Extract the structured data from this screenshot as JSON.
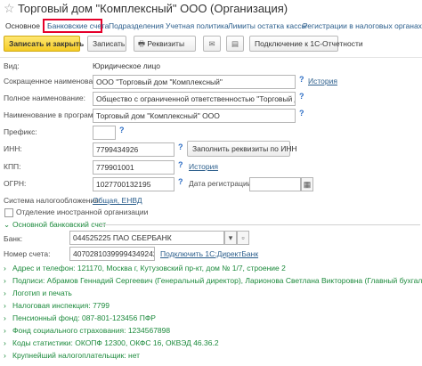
{
  "window": {
    "title": "Торговый дом \"Комплексный\" ООО (Организация)"
  },
  "tabs": [
    {
      "label": "Основное"
    },
    {
      "label": "Банковские счета"
    },
    {
      "label": "Подразделения"
    },
    {
      "label": "Учетная политика"
    },
    {
      "label": "Лимиты остатка кассы"
    },
    {
      "label": "Регистрации в налоговых органах"
    }
  ],
  "toolbar": {
    "save_close": "Записать и закрыть",
    "save": "Записать",
    "requisites": "Реквизиты",
    "connect": "Подключение к 1С-Отчетности"
  },
  "form": {
    "kind_label": "Вид:",
    "kind_value": "Юридическое лицо",
    "short_name_label": "Сокращенное наименование:",
    "short_name_value": "ООО \"Торговый дом \"Комплексный\"",
    "history": "История",
    "full_name_label": "Полное наименование:",
    "full_name_value": "Общество с ограниченной ответственностью \"Торговый дом \"Комп",
    "program_name_label": "Наименование в программе:",
    "program_name_value": "Торговый дом \"Комплексный\" ООО",
    "prefix_label": "Префикс:",
    "prefix_value": "",
    "inn_label": "ИНН:",
    "inn_value": "7799434926",
    "fill_by_inn": "Заполнить реквизиты по ИНН",
    "kpp_label": "КПП:",
    "kpp_value": "779901001",
    "kpp_history": "История",
    "ogrn_label": "ОГРН:",
    "ogrn_value": "1027700132195",
    "reg_date_label": "Дата регистрации:",
    "reg_date_value": "",
    "tax_system_label": "Система налогообложения:",
    "tax_system_value": "Общая, ЕНВД",
    "foreign_branch_label": "Отделение иностранной организации"
  },
  "bank": {
    "section_title": "Основной банковский счет",
    "bank_label": "Банк:",
    "bank_value": "044525225 ПАО СБЕРБАНК",
    "account_label": "Номер счета:",
    "account_value": "40702810399994349242",
    "direct_bank_link": "Подключить 1С:ДиректБанк"
  },
  "groups": [
    {
      "label": "Адрес и телефон: 121170, Москва г, Кутузовский пр-кт, дом № 1/7, строение 2"
    },
    {
      "label": "Подписи: Абрамов Геннадий Сергеевич (Генеральный директор), Ларионова Светлана Викторовна (Главный бухгалтер)"
    },
    {
      "label": "Логотип и печать"
    },
    {
      "label": "Налоговая инспекция: 7799"
    },
    {
      "label": "Пенсионный фонд: 087-801-123456 ПФР"
    },
    {
      "label": "Фонд социального страхования: 1234567898"
    },
    {
      "label": "Коды статистики: ОКОПФ 12300, ОКФС 16, ОКВЭД 46.36.2"
    },
    {
      "label": "Крупнейший налогоплательщик: нет"
    }
  ],
  "icons": {
    "star": "star-icon",
    "requisites": "printer-icon",
    "email": "envelope-icon",
    "document": "document-icon"
  },
  "colors": {
    "accent_link": "#2b5e8c",
    "group_green": "#1c8a3c",
    "primary_button": "#f5cc25",
    "tab_highlight": "#e5002a"
  }
}
